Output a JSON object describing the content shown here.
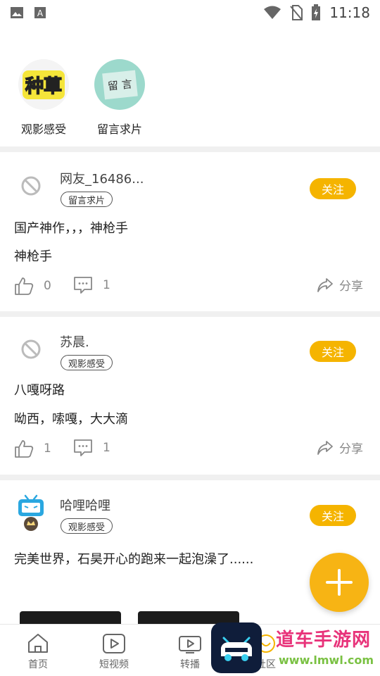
{
  "status": {
    "time": "11:18"
  },
  "topics": [
    {
      "label": "观影感受",
      "badge": "种草"
    },
    {
      "label": "留言求片",
      "badge": "留 言"
    }
  ],
  "posts": [
    {
      "user": "网友_16486...",
      "tag": "留言求片",
      "follow": "关注",
      "lines": [
        "国产神作，，，神枪手",
        "神枪手"
      ],
      "likes": "0",
      "comments": "1",
      "share": "分享"
    },
    {
      "user": "苏晨.",
      "tag": "观影感受",
      "follow": "关注",
      "lines": [
        "八嘎呀路",
        "呦西，嗦嘎，大大滴"
      ],
      "likes": "1",
      "comments": "1",
      "share": "分享"
    },
    {
      "user": "哈哩哈哩",
      "tag": "观影感受",
      "follow": "关注",
      "lines": [
        "完美世界，石昊开心的跑来一起泡澡了......"
      ]
    }
  ],
  "tabs": [
    {
      "label": "首页"
    },
    {
      "label": "短视频"
    },
    {
      "label": "转播"
    },
    {
      "label": "社区"
    }
  ],
  "watermark": {
    "title": "道车手游网",
    "url": "www.lmwl.com"
  },
  "colors": {
    "accent": "#f5b400",
    "divider": "#f0f0f0"
  }
}
